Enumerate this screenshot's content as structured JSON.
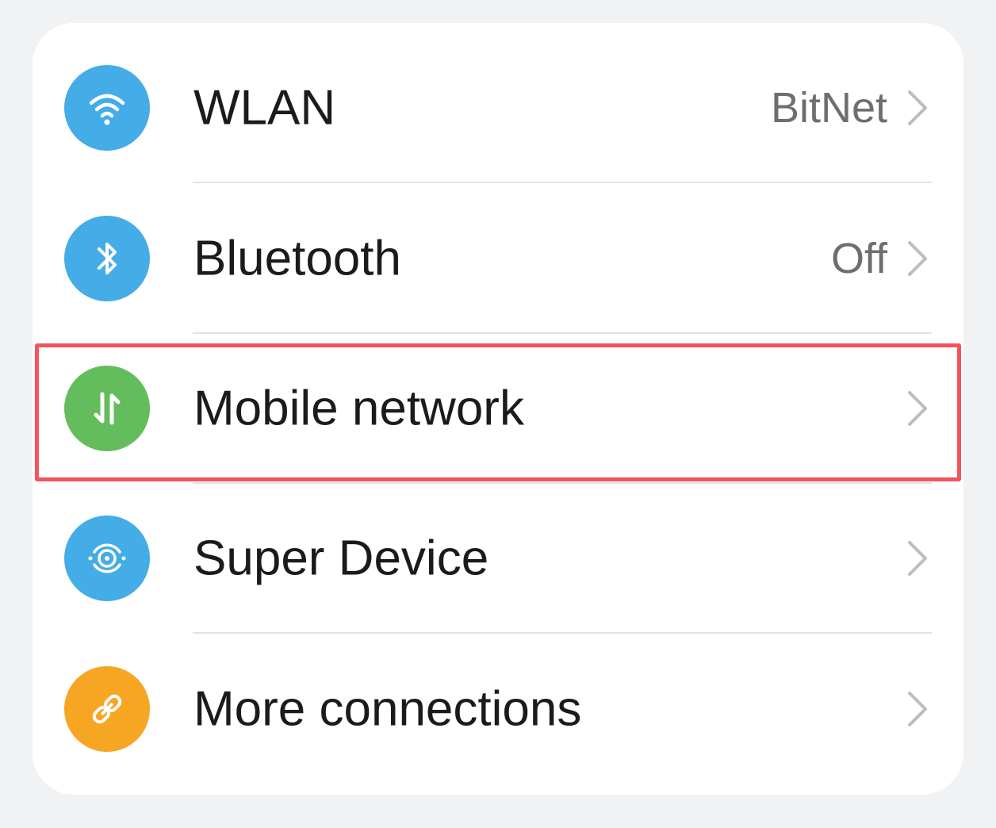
{
  "settings": {
    "items": [
      {
        "label": "WLAN",
        "value": "BitNet",
        "icon": "wifi-icon",
        "icon_color": "#44ace6"
      },
      {
        "label": "Bluetooth",
        "value": "Off",
        "icon": "bluetooth-icon",
        "icon_color": "#44ace6"
      },
      {
        "label": "Mobile network",
        "value": "",
        "icon": "mobile-data-icon",
        "icon_color": "#64bd5c"
      },
      {
        "label": "Super Device",
        "value": "",
        "icon": "super-device-icon",
        "icon_color": "#44ace6"
      },
      {
        "label": "More connections",
        "value": "",
        "icon": "link-icon",
        "icon_color": "#f6a623"
      }
    ],
    "highlight_color": "#f2555a",
    "highlighted_item": "Mobile network"
  }
}
